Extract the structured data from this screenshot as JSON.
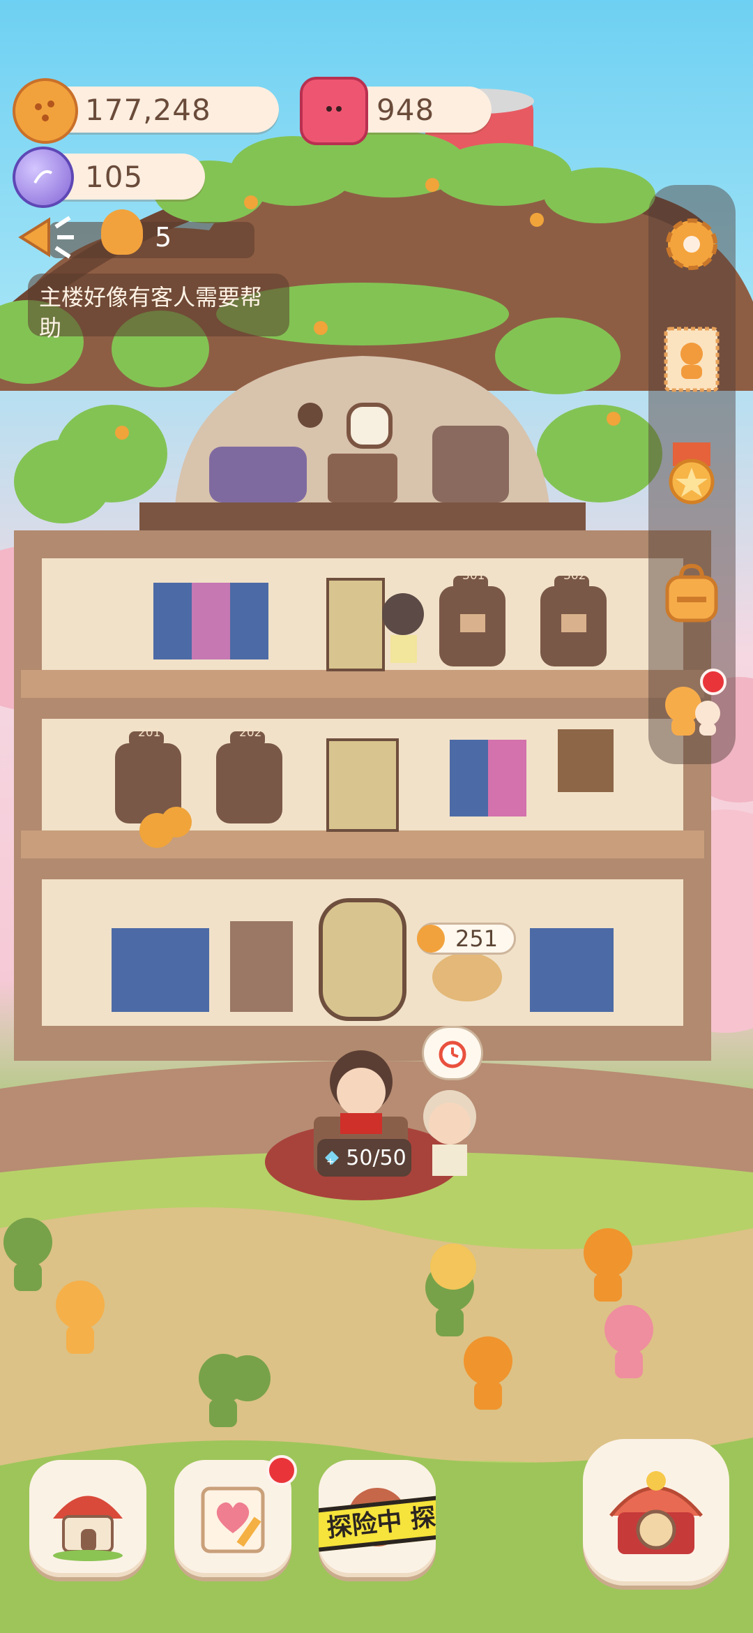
{
  "hud": {
    "cookies": "177,248",
    "gems": "948",
    "crystals": "105",
    "tickets": "5"
  },
  "announcement": "主楼好像有客人需要帮助",
  "building": {
    "room_labels": [
      "301",
      "302",
      "201",
      "202"
    ]
  },
  "lobby": {
    "coin_bubble_value": "251",
    "energy": "50/50"
  },
  "nav": {
    "expedition_label": "探险中 探"
  },
  "icons": {
    "cookie": "cookie-icon",
    "gem": "candy-gem-icon",
    "crystal": "crystal-icon",
    "megaphone": "megaphone-icon",
    "settings": "gear-icon",
    "profile": "stamp-profile-icon",
    "medal": "medal-icon",
    "backpack": "backpack-icon",
    "friends": "friends-icon",
    "hotel": "hotel-icon",
    "diary": "diary-icon",
    "expedition": "expedition-icon",
    "theater": "theater-icon"
  },
  "colors": {
    "red_badge": "#e9353a",
    "hud_pill": "#fdeee0",
    "wood": "#7a5643"
  }
}
